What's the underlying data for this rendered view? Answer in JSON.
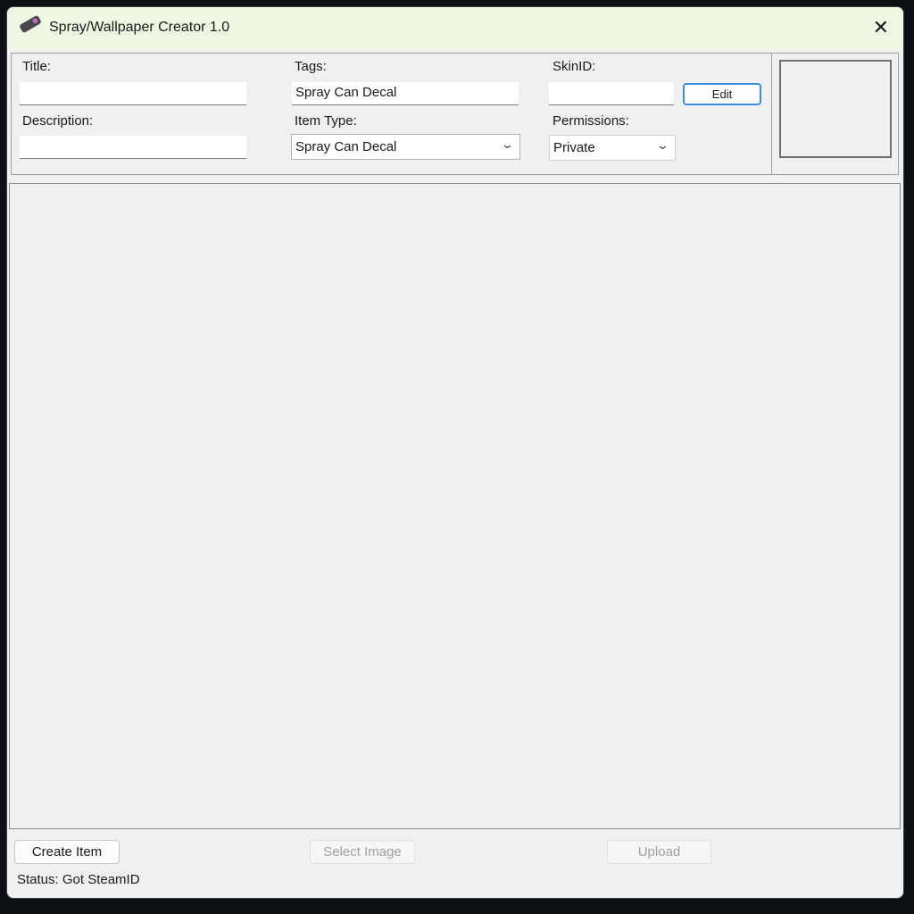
{
  "window": {
    "title": "Spray/Wallpaper Creator 1.0"
  },
  "form": {
    "title_label": "Title:",
    "title_value": "",
    "description_label": "Description:",
    "description_value": "",
    "tags_label": "Tags:",
    "tags_value": "Spray Can Decal",
    "item_type_label": "Item Type:",
    "item_type_value": "Spray Can Decal",
    "skinid_label": "SkinID:",
    "skinid_value": "",
    "edit_label": "Edit",
    "permissions_label": "Permissions:",
    "permissions_value": "Private"
  },
  "footer": {
    "create_label": "Create Item",
    "select_label": "Select Image",
    "upload_label": "Upload",
    "status": "Status: Got SteamID"
  }
}
